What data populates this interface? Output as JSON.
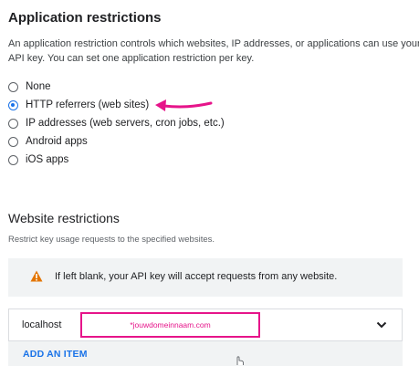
{
  "app_restrictions": {
    "heading": "Application restrictions",
    "description_line1": "An application restriction controls which websites, IP addresses, or applications can use your",
    "description_line2": "API key. You can set one application restriction per key.",
    "options": [
      {
        "label": "None",
        "selected": false
      },
      {
        "label": "HTTP referrers (web sites)",
        "selected": true
      },
      {
        "label": "IP addresses (web servers, cron jobs, etc.)",
        "selected": false
      },
      {
        "label": "Android apps",
        "selected": false
      },
      {
        "label": "iOS apps",
        "selected": false
      }
    ]
  },
  "website_restrictions": {
    "heading": "Website restrictions",
    "subtitle": "Restrict key usage requests to the specified websites.",
    "warning_icon": "warning-triangle-icon",
    "warning_text": "If left blank, your API key will accept requests from any website.",
    "items": [
      {
        "label": "localhost",
        "value": "*jouwdomeinnaam.com"
      }
    ],
    "add_item_label": "ADD AN ITEM"
  },
  "colors": {
    "accent": "#1a73e8",
    "annotation": "#e6148a",
    "warning": "#e37400"
  }
}
